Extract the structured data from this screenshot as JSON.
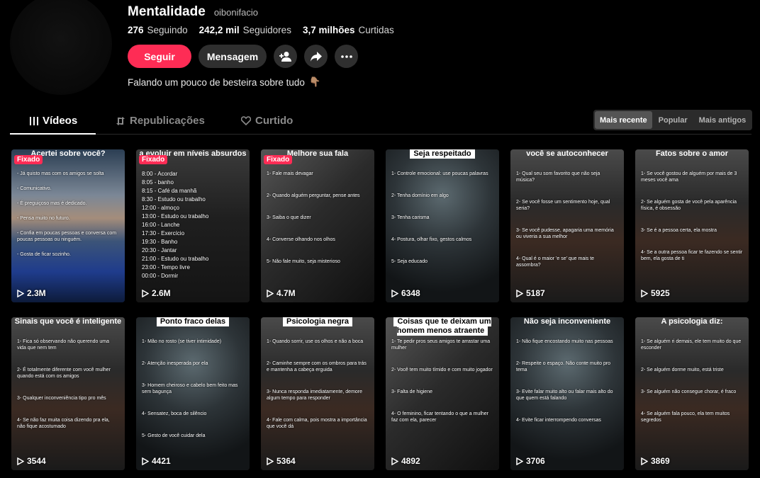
{
  "profile": {
    "name": "Mentalidade",
    "handle": "oibonifacio",
    "stats": [
      {
        "num": "276",
        "label": "Seguindo"
      },
      {
        "num": "242,2 mil",
        "label": "Seguidores"
      },
      {
        "num": "3,7 milhões",
        "label": "Curtidas"
      }
    ],
    "follow_label": "Seguir",
    "message_label": "Mensagem",
    "bio": "Falando um pouco de besteira sobre tudo",
    "bio_emoji": "👇🏽"
  },
  "tabs": [
    {
      "label": "Vídeos",
      "icon": "grid-icon"
    },
    {
      "label": "Republicações",
      "icon": "repost-icon"
    },
    {
      "label": "Curtido",
      "icon": "heart-icon"
    }
  ],
  "sort": [
    "Mais recente",
    "Popular",
    "Mais antigos"
  ],
  "videos": [
    {
      "title": "Acertei sobre você?",
      "pinned": "Fixado",
      "views": "2.3M",
      "lines": [
        "- Já quisto mas com os amigos se solta",
        "- Comunicativo.",
        "- É preguiçoso mas é dedicado.",
        "- Pensa muito no futuro.",
        "- Confia em poucas pessoas e conversa com poucas pessoas ou ninguém.",
        "- Gosta de ficar sozinho."
      ]
    },
    {
      "title": "a evoluir em níveis absurdos",
      "pinned": "Fixado",
      "views": "2.6M",
      "lines": [
        "8:00 - Acordar",
        "8:05 - banho",
        "8:15 - Café da manhã",
        "8:30 - Estudo ou trabalho",
        "12:00 - almoço",
        "13:00 - Estudo ou trabalho",
        "16:00 - Lanche",
        "17:30 - Exercício",
        "19:30 - Banho",
        "20:30 - Jantar",
        "21:00 - Estudo ou trabalho",
        "23:00 - Tempo livre",
        "00:00 - Dormir"
      ]
    },
    {
      "title": "Melhore sua fala",
      "pinned": "Fixado",
      "views": "4.7M",
      "lines": [
        "1- Fale mais devagar",
        "2- Quando alguém perguntar, pense antes",
        "3- Saiba o que dizer",
        "4- Converse olhando nos olhos",
        "5- Não fale muito, seja misterioso"
      ]
    },
    {
      "title": "Seja respeitado",
      "pinned": "",
      "views": "6348",
      "lines": [
        "1- Controle emocional: use poucas palavras",
        "2- Tenha domínio em algo",
        "3- Tenha carisma",
        "4- Postura, olhar fixo, gestos calmos",
        "5- Seja educado"
      ]
    },
    {
      "title": "você se autoconhecer",
      "pinned": "",
      "views": "5187",
      "lines": [
        "1- Qual seu som favorito que não seja música?",
        "2- Se você fosse um sentimento hoje, qual seria?",
        "3- Se você pudesse, apagaria uma memória ou viveria a sua melhor",
        "4- Qual é o maior 'e se' que mais te assombra?"
      ]
    },
    {
      "title": "Fatos sobre o amor",
      "pinned": "",
      "views": "5925",
      "lines": [
        "1- Se você gostou de alguém por mais de 3 meses você ama",
        "2- Se alguém gosta de você pela aparência física, é obsessão",
        "3- Se é a pessoa certa, ela mostra",
        "4- Se a outra pessoa ficar te fazendo se sentir bem, ela gosta de ti"
      ]
    },
    {
      "title": "Sinais que você é inteligente",
      "pinned": "",
      "views": "3544",
      "lines": [
        "1- Fica só observando não querendo uma vida que nem tem",
        "2- É totalmente diferente com você mulher quando está com os amigos",
        "3- Qualquer inconveniência tipo pro mês",
        "4- Se não faz muita coisa dizendo pra ela, não fique acostumado"
      ]
    },
    {
      "title": "Ponto fraco delas",
      "pinned": "",
      "views": "4421",
      "lines": [
        "1- Mão no rosto (se tiver intimidade)",
        "2- Atenção inesperada por ela",
        "3- Homem cheiroso e cabelo bem feito mas sem bagunça",
        "4- Sensatez, boca de silêncio",
        "5- Gesto de você cuidar dela"
      ]
    },
    {
      "title": "Psicologia negra",
      "pinned": "",
      "views": "5364",
      "lines": [
        "1- Quando sorrir, use os olhos e não a boca",
        "2- Caminhe sempre com os ombros para trás e mantenha a cabeça erguida",
        "3- Nunca responda imediatamente, demore algum tempo para responder",
        "4- Fale com calma, pois mostra a importância que você dá"
      ]
    },
    {
      "title": "Coisas que te deixam um homem menos atraente",
      "pinned": "",
      "views": "4892",
      "lines": [
        "1- Te pedir pros seus amigos te arrastar uma mulher",
        "2- Você tem muito tímido e com muito jogador",
        "3- Falta de higiene",
        "4- O feminino, ficar tentando o que a mulher faz com ela, parecer"
      ]
    },
    {
      "title": "Não seja inconveniente",
      "pinned": "",
      "views": "3706",
      "lines": [
        "1- Não fique encostando muito nas pessoas",
        "2- Respeite o espaço. Não conte muito pro tema",
        "3- Evite falar muito alto ou falar mais alto do que quem está falando",
        "4- Evite ficar interrompendo conversas"
      ]
    },
    {
      "title": "A psicologia diz:",
      "pinned": "",
      "views": "3869",
      "lines": [
        "1- Se alguém ri demais, ele tem muito do que esconder",
        "2- Se alguém dorme muito, está triste",
        "3- Se alguém não consegue chorar, é fraco",
        "4- Se alguém fala pouco, ela tem muitos segredos"
      ]
    }
  ]
}
